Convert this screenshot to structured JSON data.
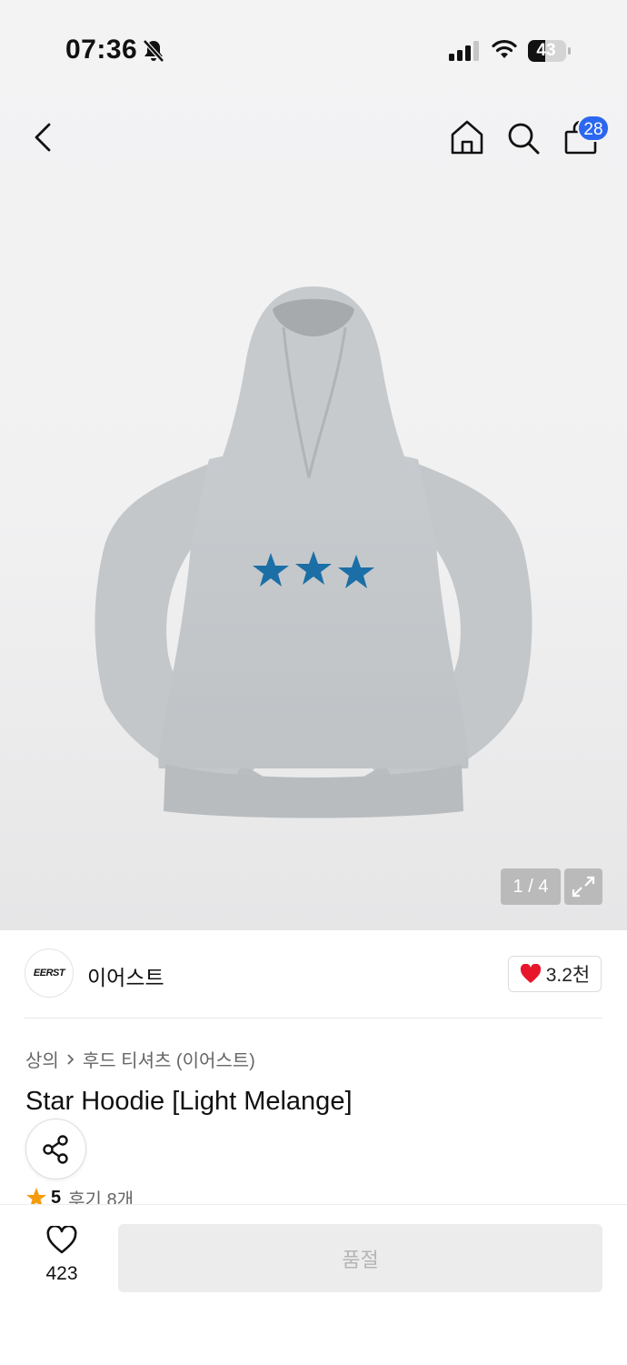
{
  "status_bar": {
    "time": "07:36",
    "battery": "43"
  },
  "header": {
    "cart_count": "28"
  },
  "gallery": {
    "pager": "1 / 4"
  },
  "brand": {
    "logo_text": "EERST",
    "name": "이어스트",
    "likes": "3.2천"
  },
  "breadcrumb": {
    "category": "상의",
    "subcategory": "후드 티셔츠 (이어스트)"
  },
  "product": {
    "title": "Star Hoodie [Light Melange]",
    "rating": "5",
    "reviews": "후기 8개"
  },
  "bottom_bar": {
    "wish_count": "423",
    "soldout_label": "품절"
  },
  "colors": {
    "accent": "#2b67f0",
    "heart": "#e8162b",
    "star_print": "#1b6fa6",
    "rating_star": "#f59b0b"
  }
}
